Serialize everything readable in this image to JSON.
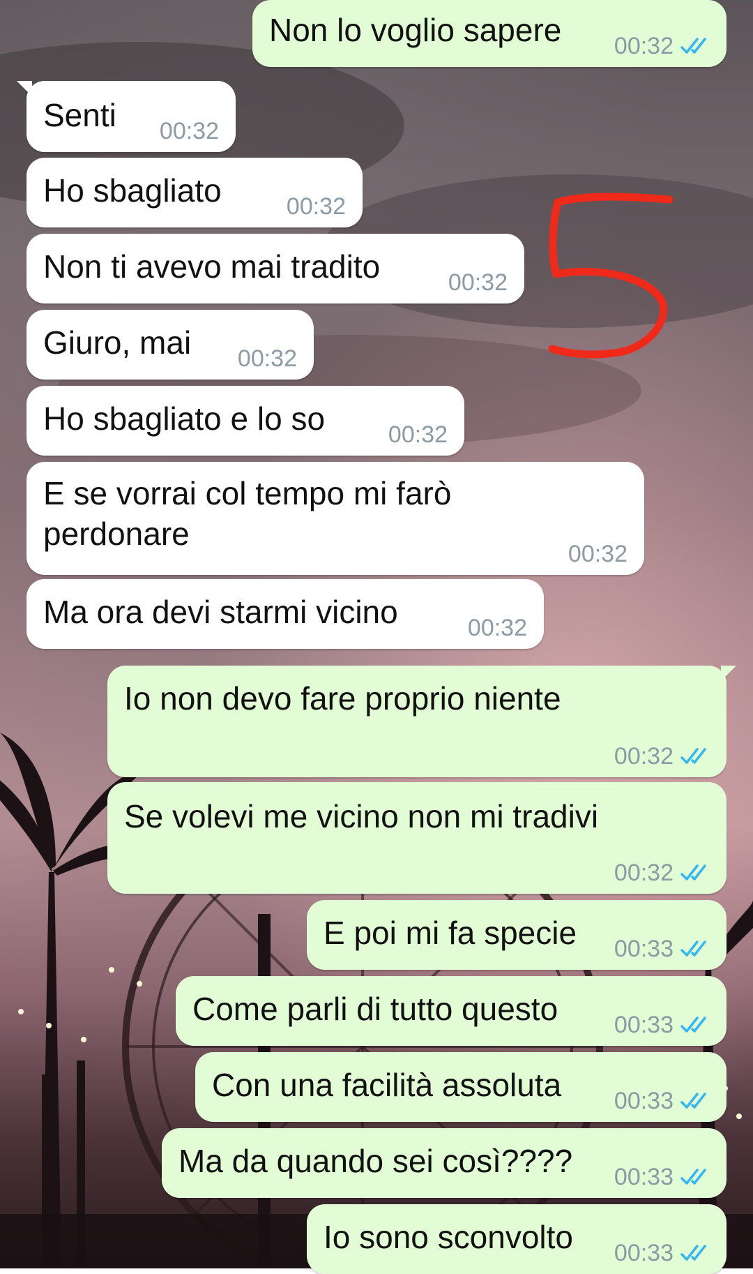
{
  "messages": [
    {
      "text": "Non lo voglio sapere",
      "time": "00:32",
      "dir": "out",
      "status_icon": "double-check-icon"
    },
    {
      "text": "Senti",
      "time": "00:32",
      "dir": "in"
    },
    {
      "text": "Ho sbagliato",
      "time": "00:32",
      "dir": "in"
    },
    {
      "text": "Non ti avevo mai tradito",
      "time": "00:32",
      "dir": "in"
    },
    {
      "text": "Giuro, mai",
      "time": "00:32",
      "dir": "in"
    },
    {
      "text": "Ho sbagliato e lo so",
      "time": "00:32",
      "dir": "in"
    },
    {
      "text": "E se vorrai col tempo mi farò perdonare",
      "time": "00:32",
      "dir": "in"
    },
    {
      "text": "Ma ora devi starmi vicino",
      "time": "00:32",
      "dir": "in"
    },
    {
      "text": "Io non devo fare proprio niente",
      "time": "00:32",
      "dir": "out",
      "status_icon": "double-check-icon"
    },
    {
      "text": "Se volevi me vicino non mi tradivi",
      "time": "00:32",
      "dir": "out",
      "status_icon": "double-check-icon"
    },
    {
      "text": "E poi mi fa specie",
      "time": "00:33",
      "dir": "out",
      "status_icon": "double-check-icon"
    },
    {
      "text": "Come parli di tutto questo",
      "time": "00:33",
      "dir": "out",
      "status_icon": "double-check-icon"
    },
    {
      "text": "Con una facilità assoluta",
      "time": "00:33",
      "dir": "out",
      "status_icon": "double-check-icon"
    },
    {
      "text": "Ma da quando sei così????",
      "time": "00:33",
      "dir": "out",
      "status_icon": "double-check-icon"
    },
    {
      "text": "Io sono sconvolto",
      "time": "00:33",
      "dir": "out",
      "status_icon": "double-check-icon"
    }
  ],
  "annotation": {
    "text": "5",
    "color": "#f02a1a"
  },
  "colors": {
    "incoming_bubble": "#ffffff",
    "outgoing_bubble": "#e2fdd5",
    "read_tick": "#34b7f1",
    "time": "#8c9aa4"
  }
}
